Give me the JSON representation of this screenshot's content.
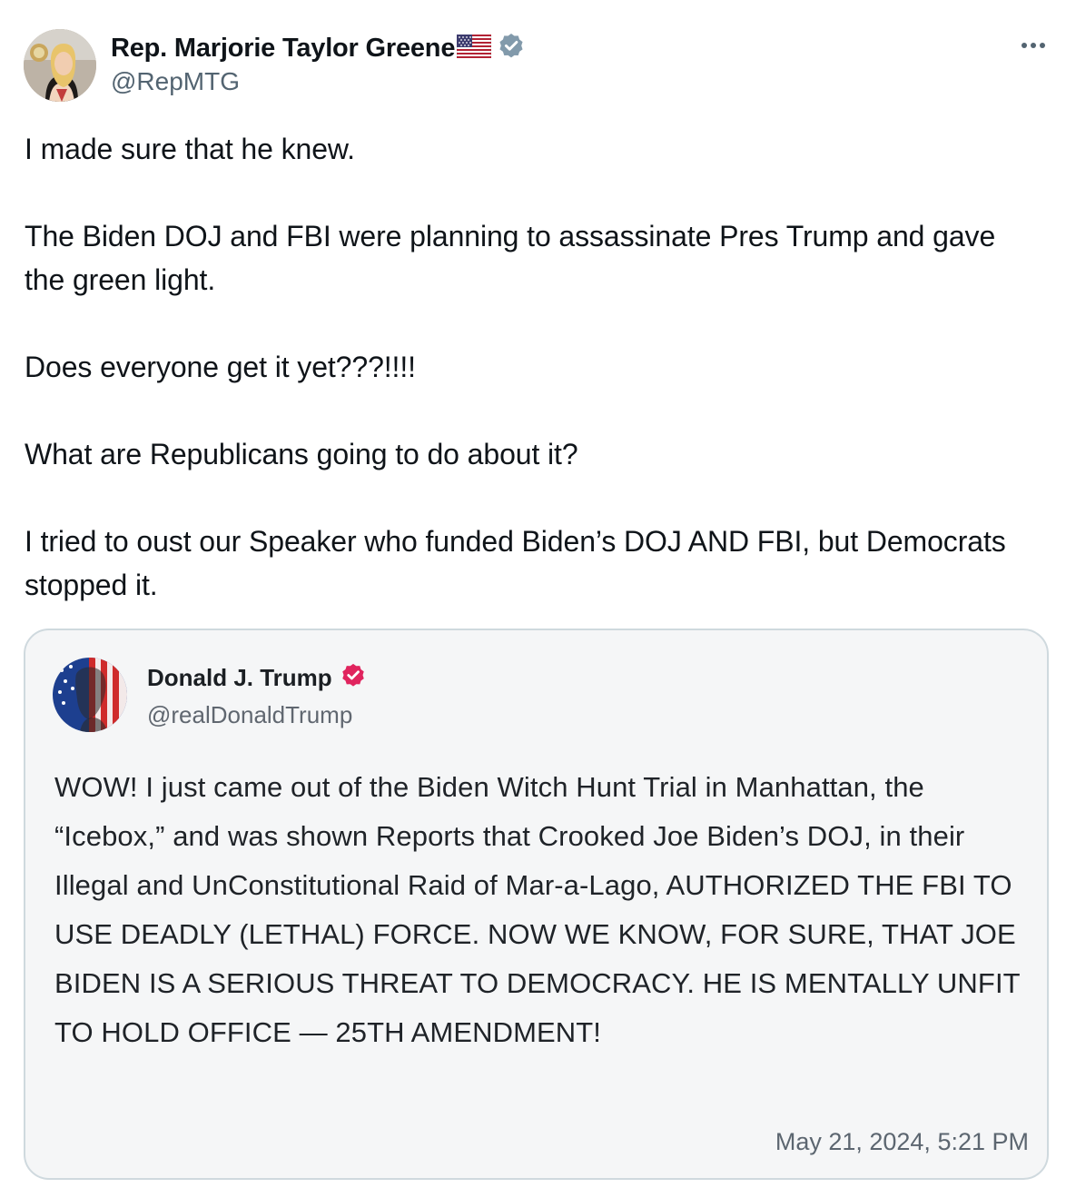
{
  "tweet": {
    "author_name": "Rep. Marjorie Taylor Greene",
    "author_handle": "@RepMTG",
    "name_flag_icon": "us-flag-icon",
    "verified_icon": "gray-verified-badge-icon",
    "more_icon": "more-options-icon",
    "paragraphs": [
      "I made sure that he knew.",
      "The Biden DOJ and FBI were planning to assassinate Pres Trump and gave the green light.",
      "Does everyone get it yet???!!!!",
      "What are Republicans going to do about it?",
      "I tried to oust our Speaker who funded Biden’s DOJ AND FBI, but Democrats stopped it."
    ]
  },
  "quoted_post": {
    "author_name": "Donald J. Trump",
    "author_handle": "@realDonaldTrump",
    "verified_icon": "red-verified-badge-icon",
    "text": "WOW! I just came out of the Biden Witch Hunt Trial in Manhattan, the “Icebox,” and was shown Reports that Crooked Joe Biden’s DOJ, in their Illegal and UnConstitutional Raid of Mar-a-Lago, AUTHORIZED THE FBI TO USE DEADLY (LETHAL) FORCE. NOW WE KNOW, FOR SURE, THAT JOE BIDEN IS A SERIOUS THREAT TO DEMOCRACY. HE IS MENTALLY UNFIT TO HOLD OFFICE — 25TH AMENDMENT!",
    "timestamp": "May 21, 2024, 5:21 PM"
  },
  "colors": {
    "text_primary": "#0f1419",
    "text_secondary": "#536471",
    "gray_badge": "#829aab",
    "red_badge": "#e0245e",
    "quote_border": "#cfd9de",
    "quote_background": "#f5f6f7"
  }
}
